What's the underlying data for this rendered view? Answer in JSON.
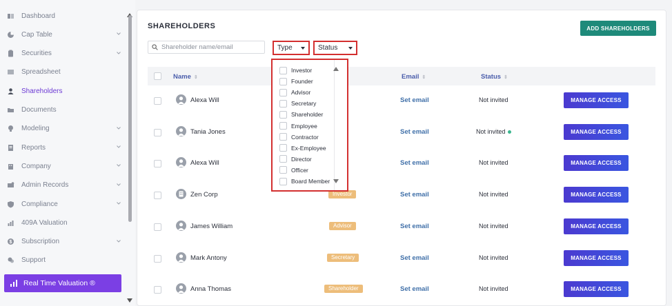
{
  "sidebar": {
    "items": [
      {
        "label": "Dashboard",
        "icon": "dashboard-icon",
        "chevron": false,
        "active": false
      },
      {
        "label": "Cap Table",
        "icon": "pie-chart-icon",
        "chevron": true,
        "active": false
      },
      {
        "label": "Securities",
        "icon": "clipboard-icon",
        "chevron": true,
        "active": false
      },
      {
        "label": "Spreadsheet",
        "icon": "spreadsheet-icon",
        "chevron": false,
        "active": false
      },
      {
        "label": "Shareholders",
        "icon": "user-icon",
        "chevron": false,
        "active": true
      },
      {
        "label": "Documents",
        "icon": "folder-icon",
        "chevron": false,
        "active": false
      },
      {
        "label": "Modeling",
        "icon": "bulb-icon",
        "chevron": true,
        "active": false
      },
      {
        "label": "Reports",
        "icon": "report-icon",
        "chevron": true,
        "active": false
      },
      {
        "label": "Company",
        "icon": "building-icon",
        "chevron": true,
        "active": false
      },
      {
        "label": "Admin Records",
        "icon": "admin-icon",
        "chevron": true,
        "active": false
      },
      {
        "label": "Compliance",
        "icon": "shield-icon",
        "chevron": true,
        "active": false
      },
      {
        "label": "409A Valuation",
        "icon": "valuation-icon",
        "chevron": false,
        "active": false
      },
      {
        "label": "Subscription",
        "icon": "dollar-icon",
        "chevron": true,
        "active": false
      },
      {
        "label": "Support",
        "icon": "support-icon",
        "chevron": false,
        "active": false
      }
    ],
    "realtime_label": "Real Time Valuation ®"
  },
  "main": {
    "title": "SHAREHOLDERS",
    "add_button": "ADD SHAREHOLDERS",
    "search_placeholder": "Shareholder name/email",
    "type_filter": "Type",
    "status_filter": "Status",
    "columns": {
      "name": "Name",
      "email": "Email",
      "status": "Status"
    },
    "type_options": [
      "Investor",
      "Founder",
      "Advisor",
      "Secretary",
      "Shareholder",
      "Employee",
      "Contractor",
      "Ex-Employee",
      "Director",
      "Officer",
      "Board Member"
    ],
    "rows": [
      {
        "name": "Alexa Will",
        "type": "",
        "email": "Set email",
        "status": "Not invited",
        "dot": false,
        "button": "MANAGE ACCESS",
        "avatar": "person-avatar-icon"
      },
      {
        "name": "Tania Jones",
        "type": "",
        "email": "Set email",
        "status": "Not invited",
        "dot": true,
        "button": "MANAGE ACCESS",
        "avatar": "person-avatar-icon"
      },
      {
        "name": "Alexa Will",
        "type": "",
        "email": "Set email",
        "status": "Not invited",
        "dot": false,
        "button": "MANAGE ACCESS",
        "avatar": "person-avatar-icon"
      },
      {
        "name": "Zen Corp",
        "type": "Investor",
        "email": "Set email",
        "status": "Not invited",
        "dot": false,
        "button": "MANAGE ACCESS",
        "avatar": "company-avatar-icon"
      },
      {
        "name": "James William",
        "type": "Advisor",
        "email": "Set email",
        "status": "Not invited",
        "dot": false,
        "button": "MANAGE ACCESS",
        "avatar": "person-avatar-icon"
      },
      {
        "name": "Mark Antony",
        "type": "Secretary",
        "email": "Set email",
        "status": "Not invited",
        "dot": false,
        "button": "MANAGE ACCESS",
        "avatar": "person-avatar-icon"
      },
      {
        "name": "Anna Thomas",
        "type": "Shareholder",
        "email": "Set email",
        "status": "Not invited",
        "dot": false,
        "button": "MANAGE ACCESS",
        "avatar": "person-avatar-icon"
      }
    ]
  },
  "colors": {
    "accent": "#7b3fe4",
    "add_button": "#1e8a7a",
    "manage_button": "#4b3ad0",
    "type_badge": "#edbd7a",
    "highlight_border": "#d32f2f",
    "status_dot": "#3cb68f"
  }
}
